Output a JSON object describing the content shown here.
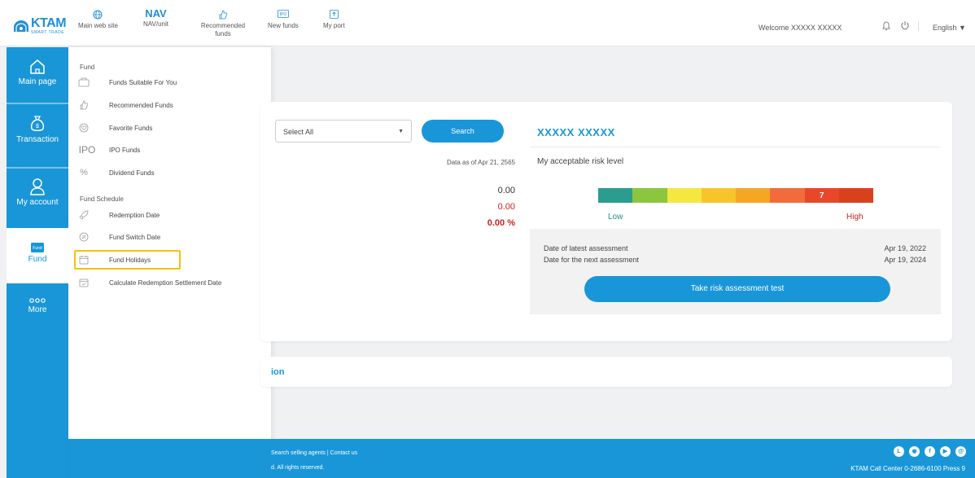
{
  "header": {
    "logo_text": "KTAM",
    "logo_sub": "SMART TRADE",
    "nav": [
      {
        "label": "Main web site",
        "big": ""
      },
      {
        "label": "NAV/unit",
        "big": "NAV"
      },
      {
        "label": "Recommended funds",
        "big": ""
      },
      {
        "label": "New funds",
        "big": ""
      },
      {
        "label": "My port",
        "big": ""
      }
    ],
    "welcome": "Welcome XXXXX XXXXX",
    "language": "English"
  },
  "sidebar": {
    "items": [
      {
        "label": "Main page",
        "icon": "home-icon"
      },
      {
        "label": "Transaction",
        "icon": "money-bag-icon"
      },
      {
        "label": "My account",
        "icon": "user-icon"
      },
      {
        "label": "Fund",
        "icon": "fund-icon"
      },
      {
        "label": "More",
        "icon": "more-icon"
      }
    ]
  },
  "flyout": {
    "section1": "Fund",
    "items1": [
      {
        "label": "Funds Suitable For You",
        "icon": "suitable-icon"
      },
      {
        "label": "Recommended Funds",
        "icon": "thumbs-up-icon"
      },
      {
        "label": "Favorite Funds",
        "icon": "heart-icon"
      },
      {
        "label": "IPO Funds",
        "icon": "ipo-icon",
        "glyph": "IPO"
      },
      {
        "label": "Dividend Funds",
        "icon": "percent-icon"
      }
    ],
    "section2": "Fund Schedule",
    "items2": [
      {
        "label": "Redemption Date",
        "icon": "rocket-icon"
      },
      {
        "label": "Fund Switch Date",
        "icon": "switch-icon"
      },
      {
        "label": "Fund Holidays",
        "icon": "calendar-icon"
      },
      {
        "label": "Calculate Redemption Settlement Date",
        "icon": "calendar-check-icon"
      }
    ]
  },
  "search": {
    "select_value": "Select All",
    "button": "Search",
    "data_as_of": "Data as of Apr 21, 2565"
  },
  "values": {
    "v1": "0.00",
    "v2": "0.00",
    "v3": "0.00 %"
  },
  "risk": {
    "name": "XXXXX XXXXX",
    "label": "My acceptable risk level",
    "level": "7",
    "low": "Low",
    "high": "High",
    "latest_label": "Date of latest assessment",
    "latest_date": "Apr 19, 2022",
    "next_label": "Date for the next assessment",
    "next_date": "Apr 19, 2024",
    "button": "Take risk assessment test",
    "colors": [
      "#2a9d8f",
      "#8cc63f",
      "#f5e642",
      "#f7c52b",
      "#f5a623",
      "#f26b3a",
      "#e8472a",
      "#d9411c"
    ]
  },
  "section_card": {
    "title": "ion"
  },
  "footer": {
    "links": "Search selling agents | Contact us",
    "copyright": "d. All rights reserved.",
    "call_center": "KTAM Call Center 0-2686-6100 Press 9"
  }
}
